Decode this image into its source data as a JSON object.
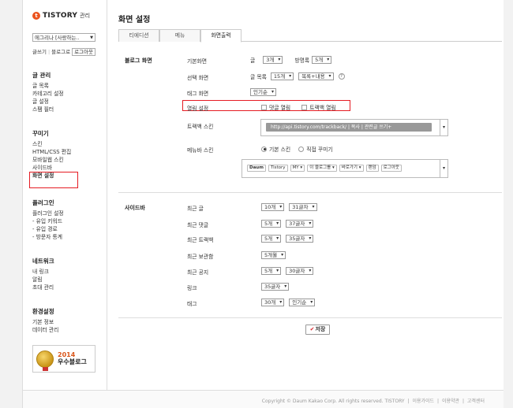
{
  "brand": {
    "logo_letter": "t",
    "name": "TISTORY",
    "suffix": "관리"
  },
  "blog_selector": {
    "value": "에그리나 [사랑하는..",
    "arrow": "▼"
  },
  "quick_links": [
    "글쓰기",
    "블로그로",
    "로그아웃"
  ],
  "sidebar": {
    "groups": [
      {
        "title": "글 관리",
        "items": [
          "글 목록",
          "카테고리 설정",
          "글 설정",
          "스팸 필터"
        ]
      },
      {
        "title": "꾸미기",
        "items": [
          "스킨",
          "HTML/CSS 편집",
          "모바일웹 스킨",
          "사이드바",
          "화면 설정"
        ]
      },
      {
        "title": "플러그인",
        "items": [
          "플러그인 설정",
          "- 유입 키워드",
          "- 유입 경로",
          "- 방문자 통계"
        ]
      },
      {
        "title": "네트워크",
        "items": [
          "내 링크",
          "알림",
          "초대 관리"
        ]
      },
      {
        "title": "환경설정",
        "items": [
          "기본 정보",
          "데이터 관리"
        ]
      }
    ],
    "active_item": "화면 설정",
    "award": {
      "year": "2014",
      "text": "우수블로그"
    }
  },
  "page": {
    "title": "화면 설정",
    "tabs": [
      "티에디션",
      "메뉴",
      "화면출력"
    ],
    "active_tab": "화면출력"
  },
  "blog_screen": {
    "section_label": "블로그 화면",
    "rows": {
      "default_screen": {
        "label": "기본화면",
        "prefix": "글",
        "count": "3개",
        "sort_label": "방명록",
        "sort_count": "5개"
      },
      "select_screen": {
        "label": "선택 화면",
        "prefix": "글 목록",
        "count": "15개",
        "mode": "목록+내용",
        "help": "?"
      },
      "tag_screen": {
        "label": "태그 화면",
        "value": "인기순"
      },
      "fold": {
        "label": "열림 설정",
        "comment": "댓글 열림",
        "trackback": "트랙백 열림"
      },
      "trackback_skin": {
        "label": "트랙백 스킨",
        "value": "http://api.tistory.com/trackback/ | 복사 | 관련글 쓰기+"
      },
      "menubar_skin": {
        "label": "메뉴바 스킨",
        "opt_default": "기본 스킨",
        "opt_custom": "직접 꾸미기",
        "items": [
          "Daum",
          "Tistory",
          "MY ▾",
          "이 블로그를 ▾",
          "바로가기 ▾",
          "랜덤",
          "로그아웃"
        ]
      }
    }
  },
  "sidebar_section": {
    "section_label": "사이드바",
    "rows": [
      {
        "label": "최근 글",
        "count": "10개",
        "chars": "31글자"
      },
      {
        "label": "최근 댓글",
        "count": "5개",
        "chars": "37글자"
      },
      {
        "label": "최근 트랙백",
        "count": "5개",
        "chars": "35글자"
      },
      {
        "label": "최근 보관함",
        "count": "5개월",
        "chars": ""
      },
      {
        "label": "최근 공지",
        "count": "5개",
        "chars": "30글자"
      },
      {
        "label": "링크",
        "count": "35글자",
        "chars": ""
      },
      {
        "label": "태그",
        "count": "30개",
        "chars": "인기순"
      }
    ]
  },
  "save": {
    "check": "✔",
    "label": "저장"
  },
  "footer": {
    "copyright": "Copyright © Daum Kakao Corp. All rights reserved. TISTORY",
    "links": [
      "이용가이드",
      "이용약관",
      "고객센터"
    ]
  }
}
